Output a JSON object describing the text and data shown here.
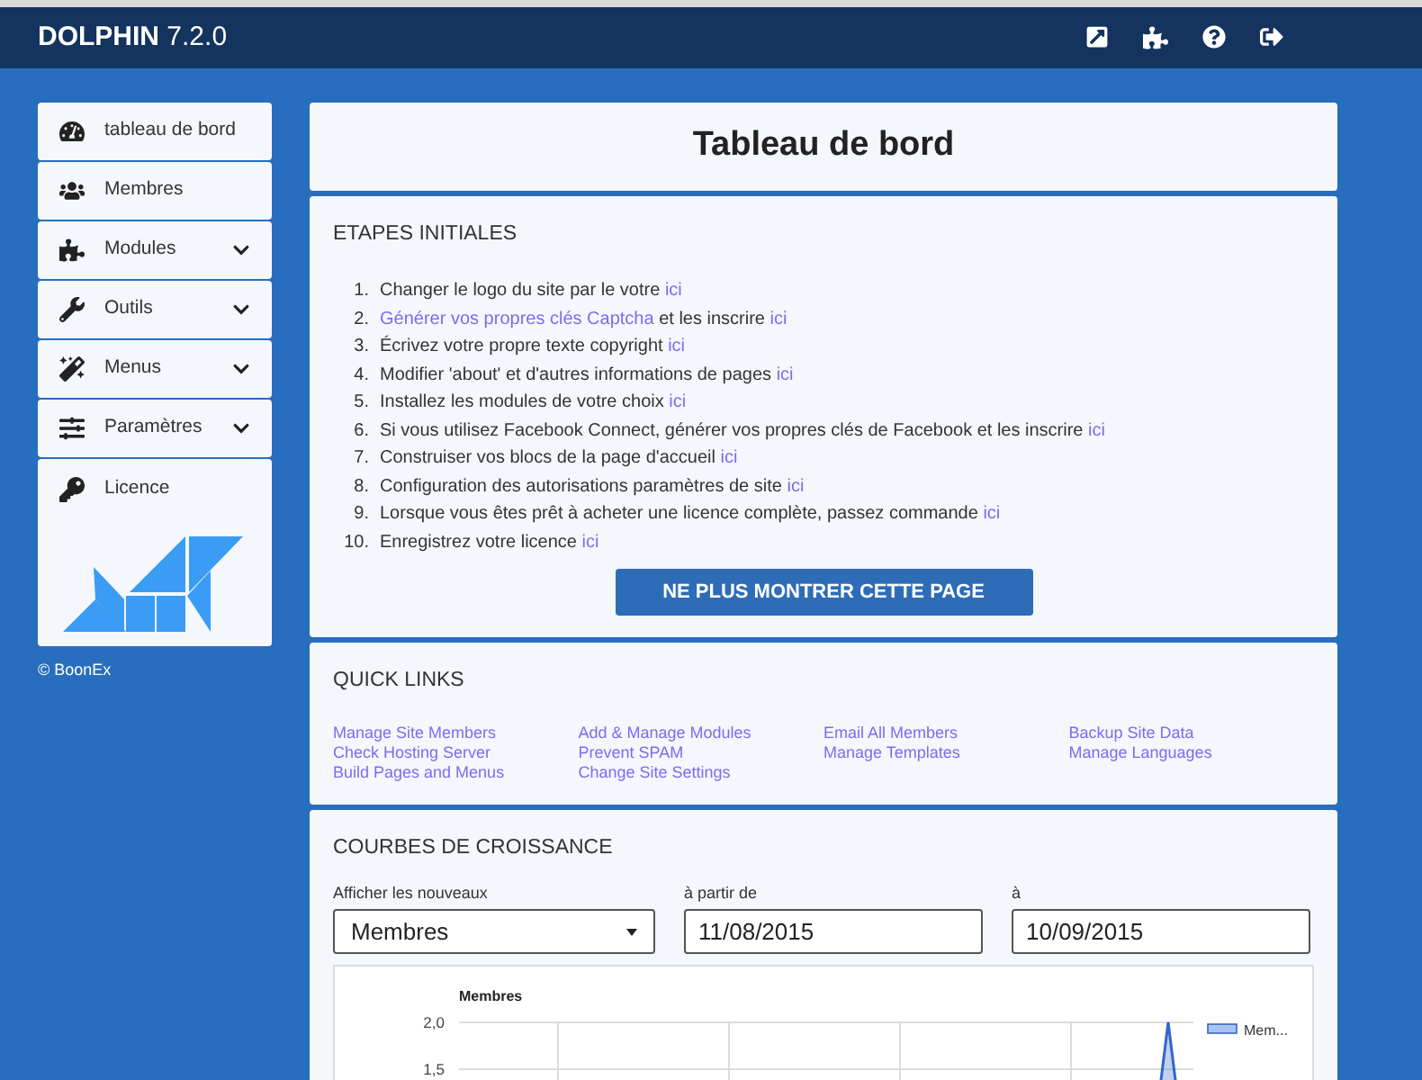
{
  "header": {
    "brand": "DOLPHIN",
    "version": "7.2.0"
  },
  "sidebar": {
    "items": [
      {
        "label": "tableau de bord",
        "expandable": false
      },
      {
        "label": "Membres",
        "expandable": false
      },
      {
        "label": "Modules",
        "expandable": true
      },
      {
        "label": "Outils",
        "expandable": true
      },
      {
        "label": "Menus",
        "expandable": true
      },
      {
        "label": "Paramètres",
        "expandable": true
      },
      {
        "label": "Licence",
        "expandable": false
      }
    ],
    "copyright": "© BoonEx"
  },
  "page_title": "Tableau de bord",
  "initial_steps": {
    "title": "ETAPES INITIALES",
    "items": [
      {
        "number": "1.",
        "parts": [
          {
            "text": "Changer le logo du site par le votre ",
            "link": false
          },
          {
            "text": "ici",
            "link": true
          }
        ]
      },
      {
        "number": "2.",
        "parts": [
          {
            "text": "Générer vos propres clés Captcha",
            "link": true
          },
          {
            "text": " et les inscrire ",
            "link": false
          },
          {
            "text": "ici",
            "link": true
          }
        ]
      },
      {
        "number": "3.",
        "parts": [
          {
            "text": "Écrivez votre propre texte copyright ",
            "link": false
          },
          {
            "text": "ici",
            "link": true
          }
        ]
      },
      {
        "number": "4.",
        "parts": [
          {
            "text": "Modifier 'about' et d'autres informations de pages ",
            "link": false
          },
          {
            "text": "ici",
            "link": true
          }
        ]
      },
      {
        "number": "5.",
        "parts": [
          {
            "text": "Installez les modules de votre choix ",
            "link": false
          },
          {
            "text": "ici",
            "link": true
          }
        ]
      },
      {
        "number": "6.",
        "parts": [
          {
            "text": "Si vous utilisez Facebook Connect, générer vos propres clés de Facebook et les inscrire ",
            "link": false
          },
          {
            "text": "ici",
            "link": true
          }
        ]
      },
      {
        "number": "7.",
        "parts": [
          {
            "text": "Construiser vos blocs de la page d'accueil ",
            "link": false
          },
          {
            "text": "ici",
            "link": true
          }
        ]
      },
      {
        "number": "8.",
        "parts": [
          {
            "text": "Configuration des autorisations paramètres de site ",
            "link": false
          },
          {
            "text": "ici",
            "link": true
          }
        ]
      },
      {
        "number": "9.",
        "parts": [
          {
            "text": "Lorsque vous êtes prêt à acheter une licence complète, passez commande ",
            "link": false
          },
          {
            "text": "ici",
            "link": true
          }
        ]
      },
      {
        "number": "10.",
        "parts": [
          {
            "text": "Enregistrez votre licence ",
            "link": false
          },
          {
            "text": "ici",
            "link": true
          }
        ]
      }
    ],
    "button": "NE PLUS MONTRER CETTE PAGE"
  },
  "quick_links": {
    "title": "QUICK LINKS",
    "columns": [
      [
        "Manage Site Members",
        "Check Hosting Server",
        "Build Pages and Menus"
      ],
      [
        "Add & Manage Modules",
        "Prevent SPAM",
        "Change Site Settings"
      ],
      [
        "Email All Members",
        "Manage Templates"
      ],
      [
        "Backup Site Data",
        "Manage Languages"
      ]
    ]
  },
  "growth": {
    "title": "COURBES DE CROISSANCE",
    "show_label": "Afficher les nouveaux",
    "show_value": "Membres",
    "from_label": "à partir de",
    "from_value": "11/08/2015",
    "to_label": "à",
    "to_value": "10/09/2015",
    "chart": {
      "title": "Membres",
      "tick_labels": [
        "2,0",
        "1,5"
      ],
      "legend": "Mem..."
    }
  }
}
